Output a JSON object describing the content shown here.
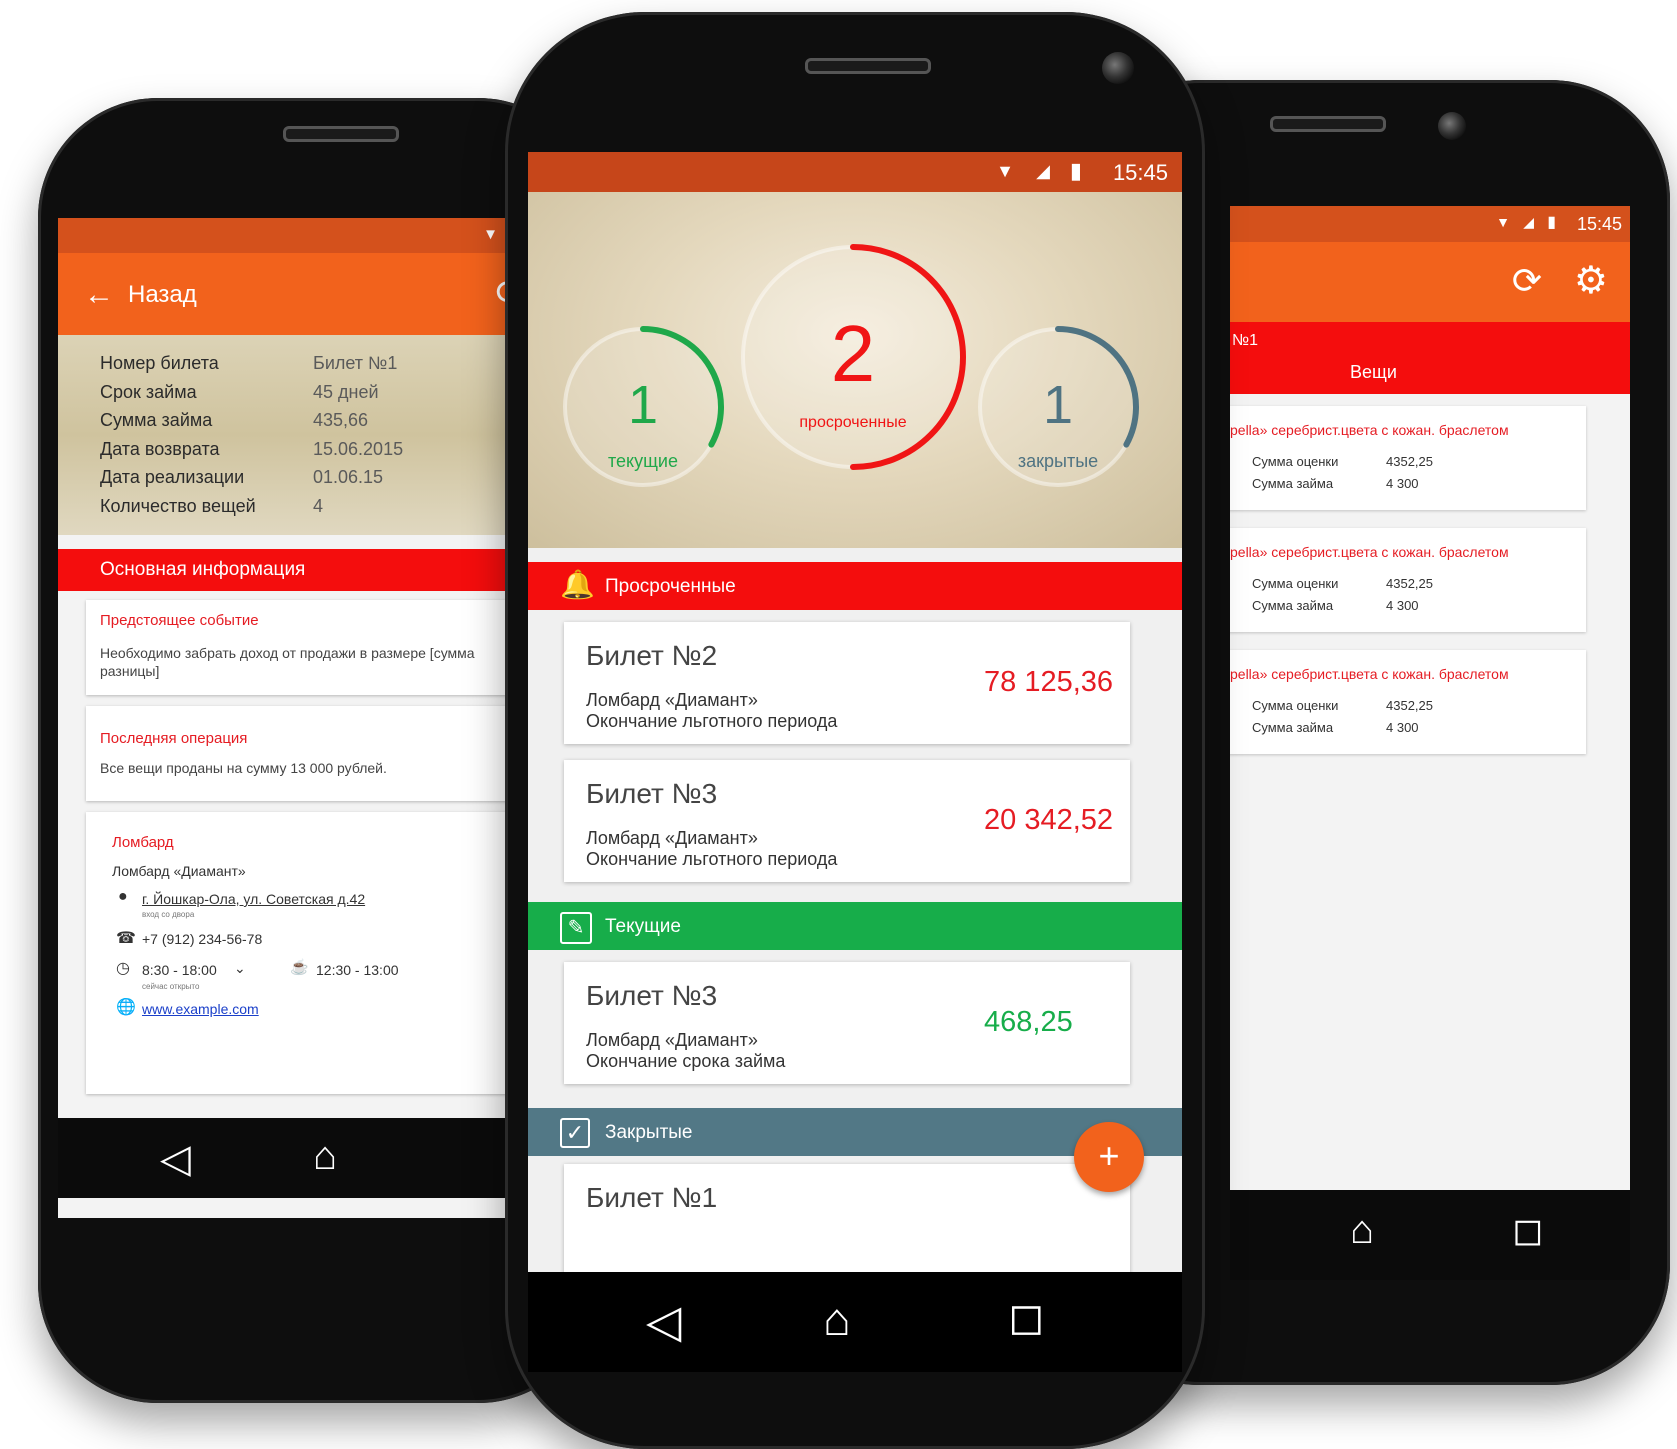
{
  "left": {
    "back_label": "Назад",
    "details": [
      {
        "label": "Номер билета",
        "value": "Билет №1"
      },
      {
        "label": "Срок займа",
        "value": "45 дней"
      },
      {
        "label": "Сумма займа",
        "value": "435,66"
      },
      {
        "label": "Дата возврата",
        "value": "15.06.2015"
      },
      {
        "label": "Дата реализации",
        "value": "01.06.15"
      },
      {
        "label": "Количество вещей",
        "value": "4"
      }
    ],
    "section_title": "Основная информация",
    "upcoming": {
      "title": "Предстоящее событие",
      "text": "Необходимо забрать доход от продажи в размере [сумма разницы]"
    },
    "last_op": {
      "title": "Последняя операция",
      "text": "Все вещи проданы на сумму  13 000 рублей."
    },
    "pawnshop": {
      "title": "Ломбард",
      "name": "Ломбард «Диамант»",
      "address": "г. Йошкар-Ола, ул. Советская д.42",
      "address_note": "вход со двора",
      "phone": "+7 (912) 234-56-78",
      "hours": "8:30 - 18:00",
      "hours_note": "сейчас открыто",
      "break": "12:30 - 13:00",
      "website": "www.example.com"
    }
  },
  "center": {
    "status_time": "15:45",
    "stats": [
      {
        "count": "1",
        "label": "текущие",
        "color": "#1fa84a",
        "fraction": 0.33
      },
      {
        "count": "2",
        "label": "просроченные",
        "color": "#f01515",
        "fraction": 0.5
      },
      {
        "count": "1",
        "label": "закрытые",
        "color": "#4f7382",
        "fraction": 0.33
      }
    ],
    "overdue": {
      "header": "Просроченные",
      "color": "#f40d0d",
      "items": [
        {
          "title": "Билет №2",
          "line1": "Ломбард «Диамант»",
          "line2": "Окончание льготного периода",
          "amount": "78 125,36"
        },
        {
          "title": "Билет №3",
          "line1": "Ломбард «Диамант»",
          "line2": "Окончание льготного периода",
          "amount": "20 342,52"
        }
      ]
    },
    "current": {
      "header": "Текущие",
      "color": "#17ad4a",
      "items": [
        {
          "title": "Билет №3",
          "line1": "Ломбард «Диамант»",
          "line2": "Окончание срока займа",
          "amount": "468,25"
        }
      ]
    },
    "closed": {
      "header": "Закрытые",
      "color": "#527886",
      "items": [
        {
          "title": "Билет №1"
        }
      ]
    },
    "fab_label": "+"
  },
  "right": {
    "status_time": "15:45",
    "ticket_label": "№1",
    "tab_label": "Вещи",
    "items": [
      {
        "title": "pella» серебрист.цвета с кожан. браслетом",
        "appraisal_label": "Сумма оценки",
        "appraisal": "4352,25",
        "loan_label": "Сумма займа",
        "loan": "4 300"
      },
      {
        "title": "pella» серебрист.цвета с кожан. браслетом",
        "appraisal_label": "Сумма оценки",
        "appraisal": "4352,25",
        "loan_label": "Сумма займа",
        "loan": "4 300"
      },
      {
        "title": "pella» серебрист.цвета с кожан. браслетом",
        "appraisal_label": "Сумма оценки",
        "appraisal": "4352,25",
        "loan_label": "Сумма займа",
        "loan": "4 300"
      }
    ]
  },
  "colors": {
    "toolbar_orange": "#f2621c",
    "status_dark_orange": "#c6461a",
    "accent_red": "#f40d0d",
    "green": "#17ad4a",
    "slate": "#527886"
  }
}
